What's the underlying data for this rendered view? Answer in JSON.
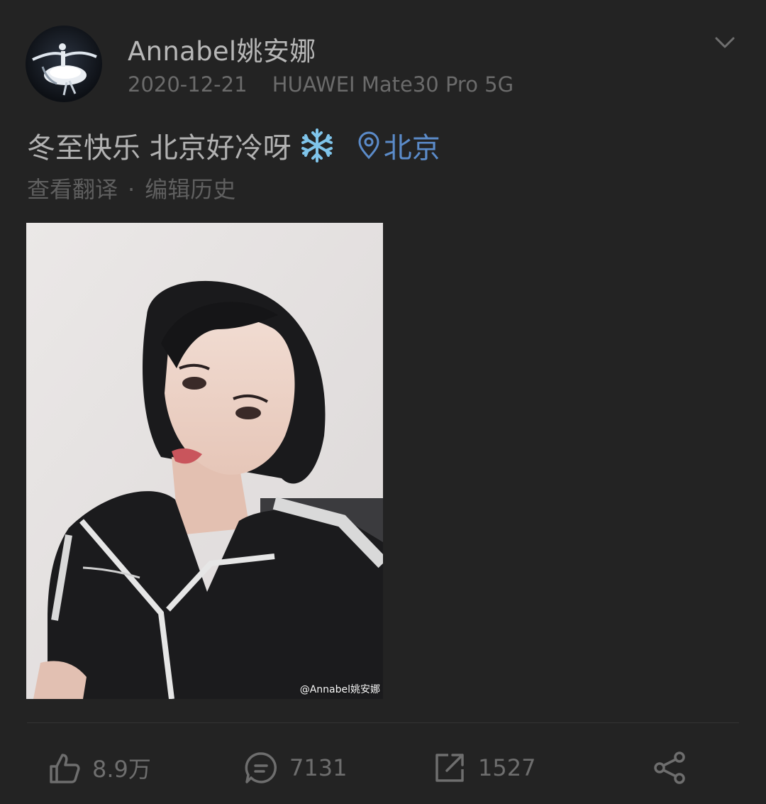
{
  "post": {
    "username": "Annabel姚安娜",
    "date": "2020-12-21",
    "device": "HUAWEI Mate30 Pro 5G",
    "text": "冬至快乐 北京好冷呀",
    "emoji": "snowflake-icon",
    "location": "北京",
    "translate_label": "查看翻译",
    "separator": "·",
    "edit_history_label": "编辑历史",
    "image_watermark": "@Annabel姚安娜"
  },
  "actions": {
    "likes": "8.9万",
    "comments": "7131",
    "reposts": "1527"
  },
  "colors": {
    "background": "#232323",
    "link": "#5b8bc9",
    "text_primary": "#b2b2b2",
    "text_secondary": "#6b6b6b"
  }
}
